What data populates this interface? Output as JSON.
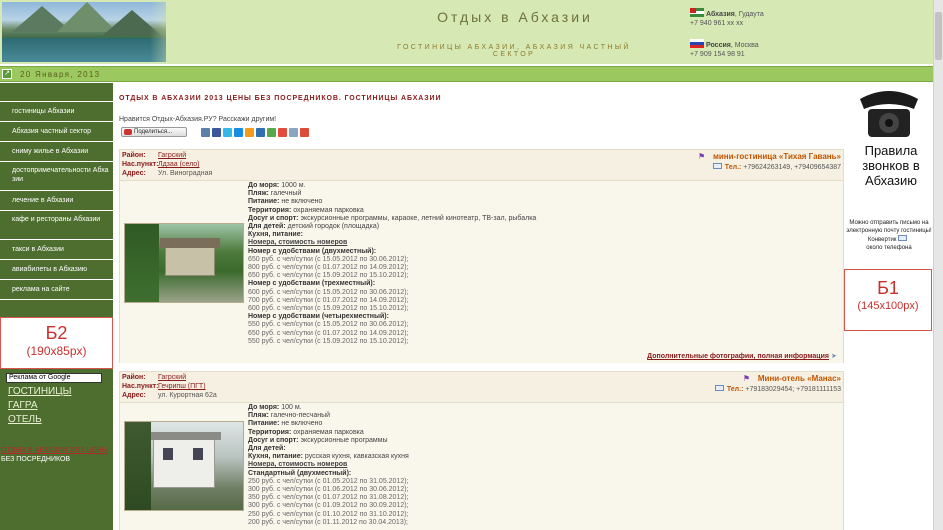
{
  "header": {
    "title": "Отдых в Абхазии",
    "subtitle": "ГОСТИНИЦЫ АБХАЗИИ, АБХАЗИЯ ЧАСТНЫЙ СЕКТОР",
    "contacts": [
      {
        "country": "Абхазия",
        "city": ", Гудаута",
        "phone": "+7 940 961 xx xx",
        "flag": "abkhazia-flag"
      },
      {
        "country": "Россия",
        "city": ", Москва",
        "phone": "+7 909 154 98 91",
        "flag": "russia-flag"
      }
    ]
  },
  "datebar": {
    "date": "20 Января, 2013",
    "home_icon": "home-icon"
  },
  "sidebar": {
    "items": [
      "гостиницы Абхазии",
      "Абхазия частный сектор",
      "сниму жилье в Абхазии",
      "достопримечательности Абхазии",
      "лечение в Абхазии",
      "кафе и рестораны Абхазии",
      "такси в Абхазии",
      "авиабилеты в Абхазию",
      "реклама на сайте"
    ],
    "ad_b2": {
      "title": "Б2",
      "size": "(190х85px)"
    },
    "google_ad": "Реклама от Google",
    "links": [
      "ГОСТИНИЦЫ",
      "ГАГРА",
      "ОТЕЛЬ"
    ],
    "red_link": "ОТДЫХ В АБХАЗИИ 2013 ЦЕНЫ",
    "white_text": "БЕЗ ПОСРЕДНИКОВ"
  },
  "main": {
    "heading": "ОТДЫХ В АБХАЗИИ 2013 ЦЕНЫ БЕЗ ПОСРЕДНИКОВ. ГОСТИНИЦЫ АБХАЗИИ",
    "share_prompt": "Нравится Отдых-Абхазия.РУ? Расскажи другим!",
    "share_button": "Поделиться...",
    "social_icons": [
      "vk-icon",
      "facebook-icon",
      "twitter-icon",
      "mailru-icon",
      "odnoklassniki-icon",
      "livejournal-icon",
      "liveinternet-icon",
      "yandex-icon",
      "bookmark-icon",
      "google-icon"
    ],
    "labels": {
      "region": "Район:",
      "locality": "Нас.пункт:",
      "address": "Адрес:",
      "tel": "Тел.:"
    },
    "listings": [
      {
        "region": "Гагрский",
        "locality": "Лдзаа (село)",
        "address": "Ул. Виноградная",
        "name": "мини-гостиница «Тихая Гавань»",
        "phones": "+79624263149, +79409654387",
        "details": [
          {
            "k": "До моря:",
            "v": " 1000 м."
          },
          {
            "k": "Пляж:",
            "v": " галечный"
          },
          {
            "k": "Питание:",
            "v": " не включено"
          },
          {
            "k": "Территория:",
            "v": " охраняемая парковка"
          },
          {
            "k": "Досуг и спорт:",
            "v": " экскурсионные программы, караоке, летний кинотеатр, ТВ-зал, рыбалка"
          },
          {
            "k": "Для детей:",
            "v": " детский городок (площадка)"
          },
          {
            "k": "Кухня, питание:",
            "v": ""
          }
        ],
        "prices_title": "Номера, стоимость номеров",
        "rooms": [
          {
            "title": "Номер с удобствами (двухместный):",
            "prices": [
              "650 руб. с чел/сутки (с 15.05.2012 по 30.06.2012);",
              "800 руб. с чел/сутки (с 01.07.2012 по 14.09.2012);",
              "650 руб. с чел/сутки (с 15.09.2012 по 15.10.2012);"
            ]
          },
          {
            "title": "Номер с удобствами (трехместный):",
            "prices": [
              "600 руб. с чел/сутки (с 15.05.2012 по 30.06.2012);",
              "700 руб. с чел/сутки (с 01.07.2012 по 14.09.2012);",
              "600 руб. с чел/сутки (с 15.09.2012 по 15.10.2012);"
            ]
          },
          {
            "title": "Номер с удобствами (четырехместный):",
            "prices": [
              "550 руб. с чел/сутки (с 15.05.2012 по 30.06.2012);",
              "650 руб. с чел/сутки (с 01.07.2012 по 14.09.2012);",
              "550 руб. с чел/сутки (с 15.09.2012 по 15.10.2012);"
            ]
          }
        ],
        "more_link": "Дополнительные фотографии, полная информация"
      },
      {
        "region": "Гагрский",
        "locality": "Гечрипш (ПГТ)",
        "address": "ул. Курортная 62а",
        "name": "Мини-отель «Манас»",
        "phones": "+79183029454; +79181111153",
        "details": [
          {
            "k": "До моря:",
            "v": " 100 м."
          },
          {
            "k": "Пляж:",
            "v": " галечно-песчаный"
          },
          {
            "k": "Питание:",
            "v": " не включено"
          },
          {
            "k": "Территория:",
            "v": " охраняемая парковка"
          },
          {
            "k": "Досуг и спорт:",
            "v": " экскурсионные программы"
          },
          {
            "k": "Для детей:",
            "v": ""
          },
          {
            "k": "Кухня, питание:",
            "v": " русская кухня, кавказская кухня"
          }
        ],
        "prices_title": "Номера, стоимость номеров",
        "rooms": [
          {
            "title": "Стандартный (двухместный):",
            "prices": [
              "250 руб. с чел/сутки (с 01.05.2012 по 31.05.2012);",
              "300 руб. с чел/сутки (с 01.06.2012 по 30.06.2012);",
              "350 руб. с чел/сутки (с 01.07.2012 по 31.08.2012);",
              "300 руб. с чел/сутки (с 01.09.2012 по 30.09.2012);",
              "250 руб. с чел/сутки (с 01.10.2012 по 31.10.2012);",
              "200 руб. с чел/сутки (с 01.11.2012 по 30.04.2013);"
            ]
          }
        ]
      }
    ]
  },
  "right": {
    "phone_ad_text": "Правила звонков в Абхазию",
    "letter_text": "Можно отправить письмо на электронную почту гостиницы!",
    "letter_label": "Конвертик",
    "letter_label2": "около телефона",
    "ad_b1": {
      "title": "Б1",
      "size": "(145х100px)"
    }
  }
}
